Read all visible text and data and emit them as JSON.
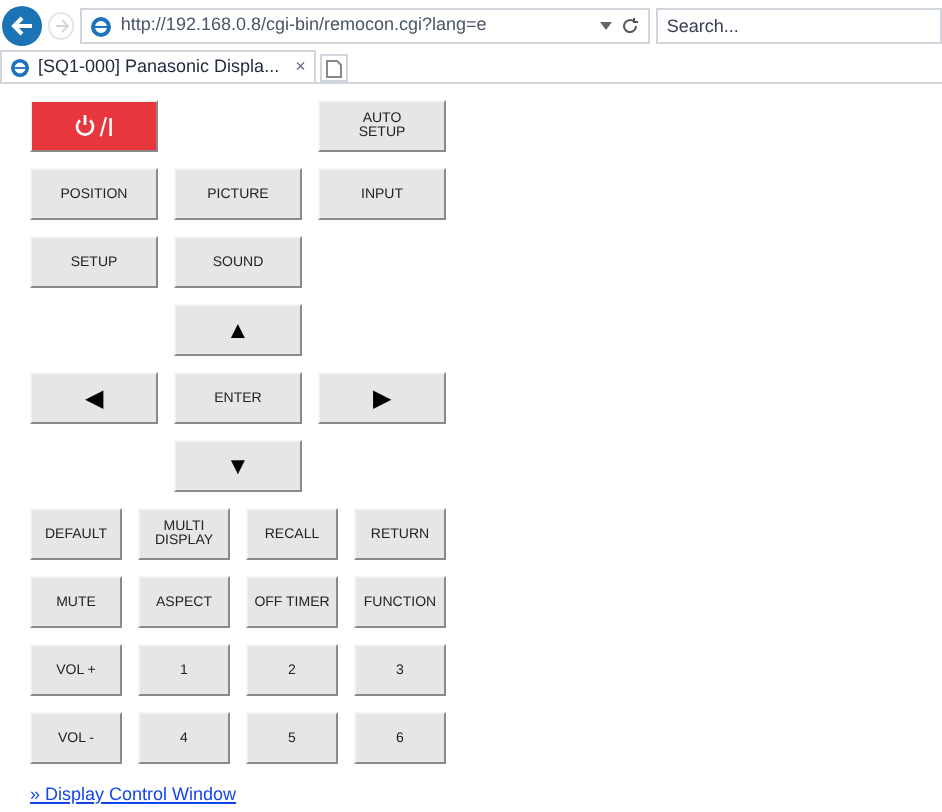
{
  "browser": {
    "address": "http://192.168.0.8/cgi-bin/remocon.cgi?lang=e",
    "search": {
      "placeholder": "Search..."
    },
    "back_disabled": false,
    "forward_disabled": true
  },
  "tabs": [
    {
      "title": "[SQ1-000] Panasonic Displa...",
      "close": "×",
      "selected": true
    }
  ],
  "main_pad": [
    {
      "left": {
        "kind": "power",
        "label": "/I"
      },
      "right": {
        "kind": "text",
        "label": "AUTO\nSETUP"
      }
    },
    {
      "left": {
        "kind": "text",
        "label": "POSITION"
      },
      "middle": {
        "kind": "text",
        "label": "PICTURE"
      },
      "right": {
        "kind": "text",
        "label": "INPUT"
      }
    },
    {
      "left": {
        "kind": "text",
        "label": "SETUP"
      },
      "middle": {
        "kind": "text",
        "label": "SOUND"
      }
    },
    {
      "middle": {
        "kind": "arrow",
        "label": "▲"
      }
    },
    {
      "left": {
        "kind": "arrow",
        "label": "◀"
      },
      "middle": {
        "kind": "text",
        "label": "ENTER"
      },
      "right": {
        "kind": "arrow",
        "label": "▶"
      }
    },
    {
      "middle": {
        "kind": "arrow",
        "label": "▼"
      }
    }
  ],
  "function_pad": [
    [
      "DEFAULT",
      "MULTI\nDISPLAY",
      "RECALL",
      "RETURN"
    ],
    [
      "MUTE",
      "ASPECT",
      "OFF TIMER",
      "FUNCTION"
    ],
    [
      "VOL +",
      "1",
      "2",
      "3"
    ],
    [
      "VOL -",
      "4",
      "5",
      "6"
    ]
  ],
  "link": "» Display Control Window"
}
